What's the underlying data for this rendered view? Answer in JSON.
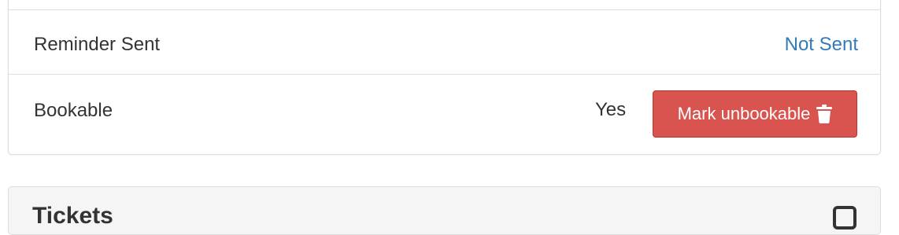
{
  "details": {
    "reminder": {
      "label": "Reminder Sent",
      "value": "Not Sent"
    },
    "bookable": {
      "label": "Bookable",
      "value": "Yes",
      "button_label": "Mark unbookable",
      "button_icon": "trash-icon"
    }
  },
  "tickets_panel": {
    "title": "Tickets",
    "corner_icon": "edit-icon"
  },
  "colors": {
    "link": "#337ab7",
    "danger": "#d9534f",
    "danger_border": "#c9302c",
    "border": "#dddddd",
    "panel_heading_bg": "#f5f5f5"
  }
}
